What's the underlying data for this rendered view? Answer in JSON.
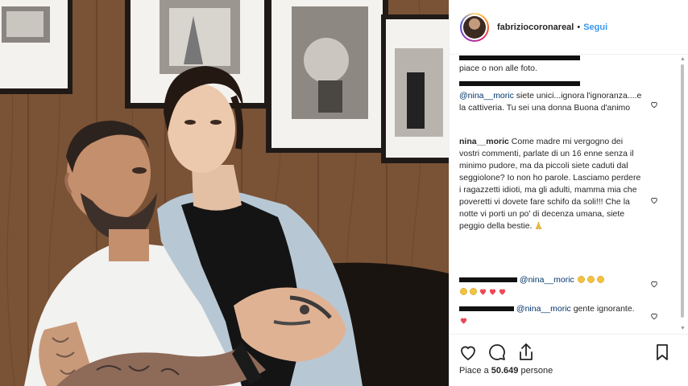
{
  "post": {
    "username": "fabriziocoronareal",
    "separator": "•",
    "follow_label": "Segui"
  },
  "comments": [
    {
      "text": "piace o non alle foto."
    },
    {
      "mention": "@nina__moric",
      "text": " siete unici...ignora l'ignoranza....e la cattiveria. Tu sei una donna Buona d'animo"
    },
    {
      "user": "nina__moric",
      "text": " Come madre mi vergogno dei vostri commenti, parlate di un 16 enne senza il minimo pudore, ma da piccoli siete caduti dal seggiolone? Io non ho parole. Lasciamo perdere i ragazzetti idioti, ma gli adulti, mamma mia che poveretti vi dovete fare schifo da soli!!! Che la notte vi porti un po' di decenza umana, siete peggio della bestie."
    },
    {
      "mention": "@nina__moric"
    },
    {
      "mention": "@nina__moric",
      "text": " gente ignorante."
    }
  ],
  "likes": {
    "prefix": "Piace a ",
    "count": "50.649",
    "suffix": " persone"
  },
  "icons": [
    "heart-icon",
    "comment-icon",
    "share-icon",
    "bookmark-icon",
    "clap-emoji",
    "red-heart-emoji",
    "pray-emoji"
  ],
  "colors": {
    "accent": "#3897f0",
    "mention": "#003569",
    "heart": "#ed4956",
    "text": "#262626"
  }
}
